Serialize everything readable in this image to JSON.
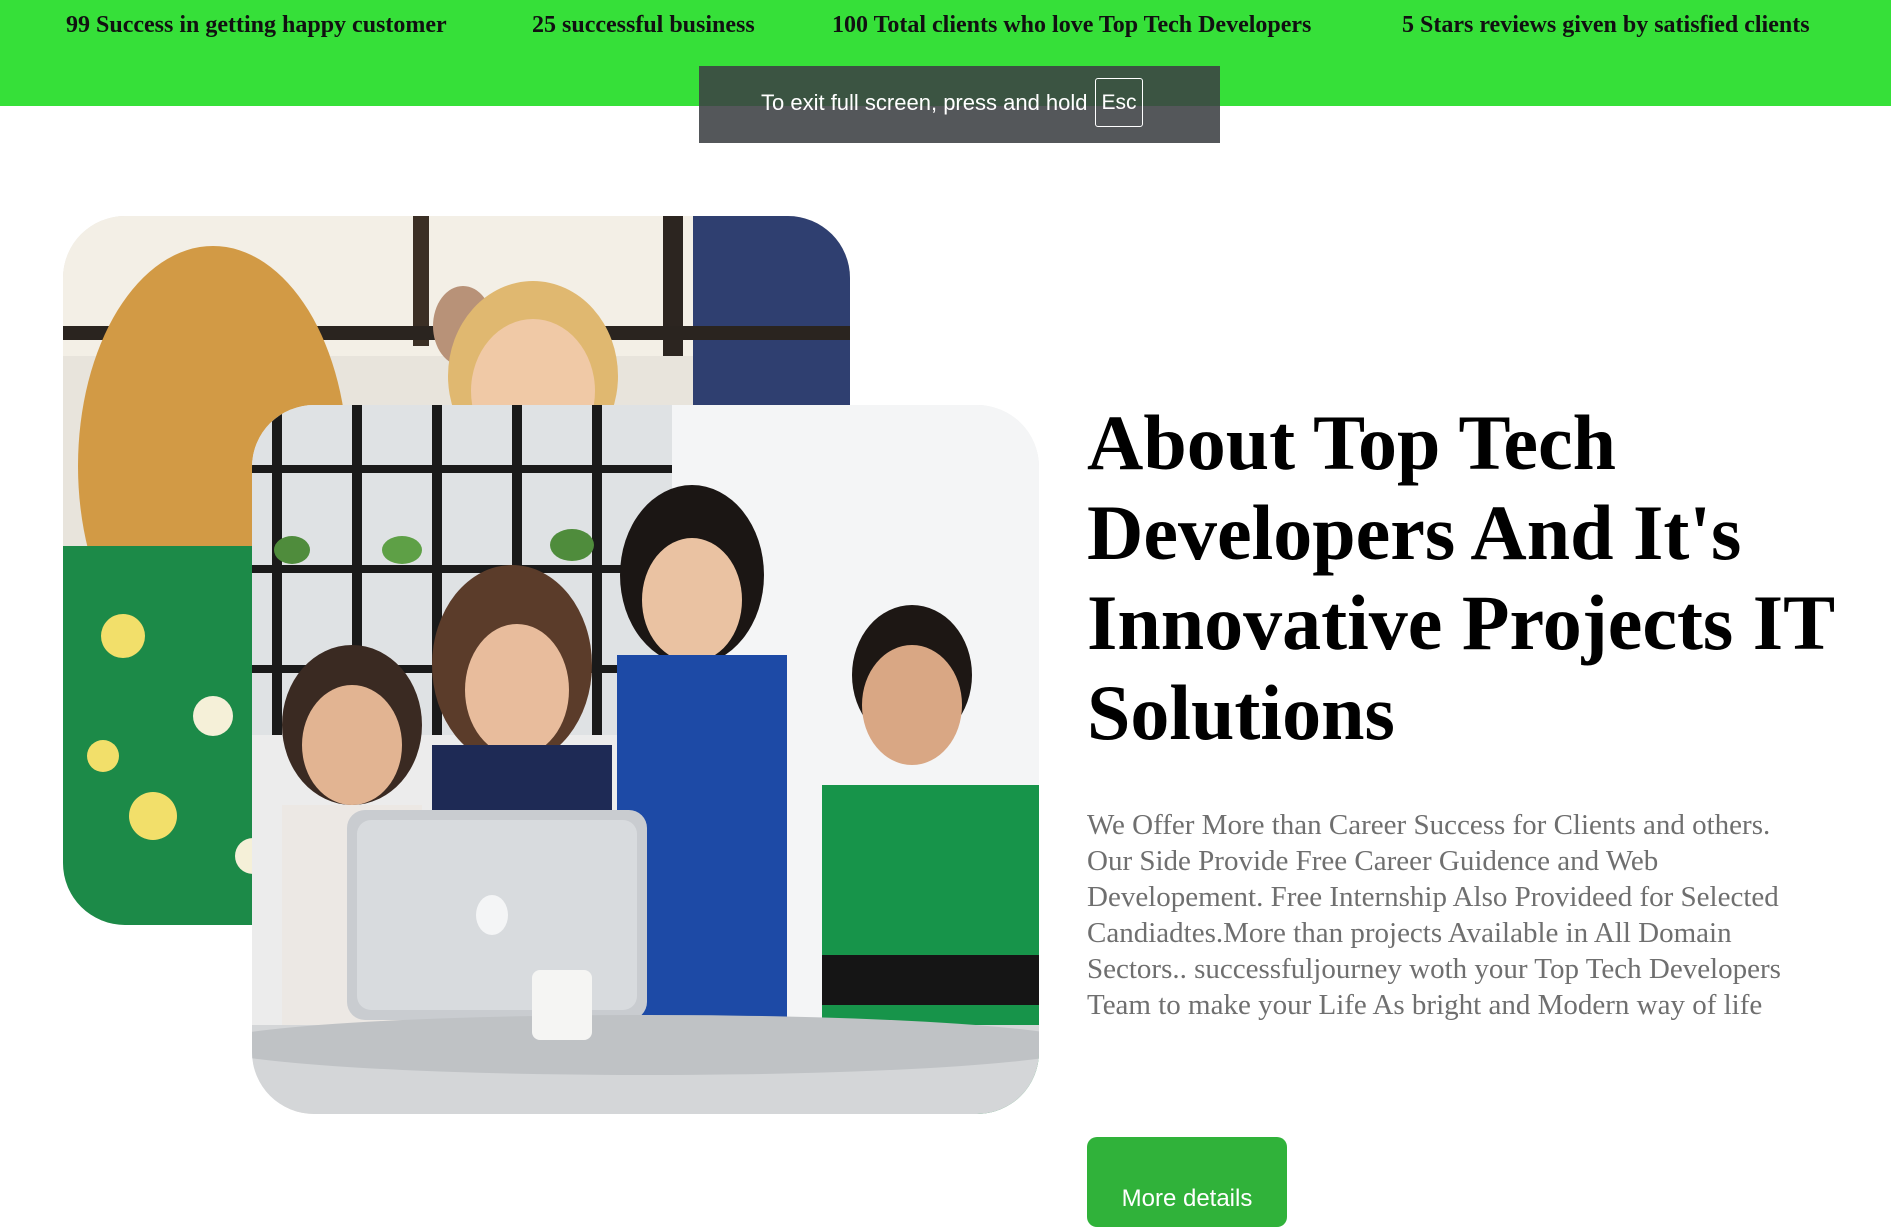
{
  "stats": [
    {
      "label": "99 Success in getting happy customer"
    },
    {
      "label": "25 successful business"
    },
    {
      "label": "100 Total clients who love Top Tech Developers"
    },
    {
      "label": "5 Stars reviews given by satisfied clients"
    }
  ],
  "fullscreen_notice": {
    "message": "To exit full screen, press and hold",
    "key": "Esc"
  },
  "about": {
    "title": "About Top Tech Developers And It's Innovative Projects IT Solutions",
    "description": "We Offer More than Career Success for Clients and others. Our Side Provide Free Career Guidence and Web Developement. Free Internship Also Provideed for Selected Candiadtes.More than projects Available in All Domain Sectors.. successfuljourney woth your Top Tech Developers Team to make your Life As bright and Modern way of life",
    "button_label": "More details"
  },
  "colors": {
    "stats_bar": "#36e039",
    "button": "#30b23a",
    "paragraph": "#6f6f6f"
  }
}
